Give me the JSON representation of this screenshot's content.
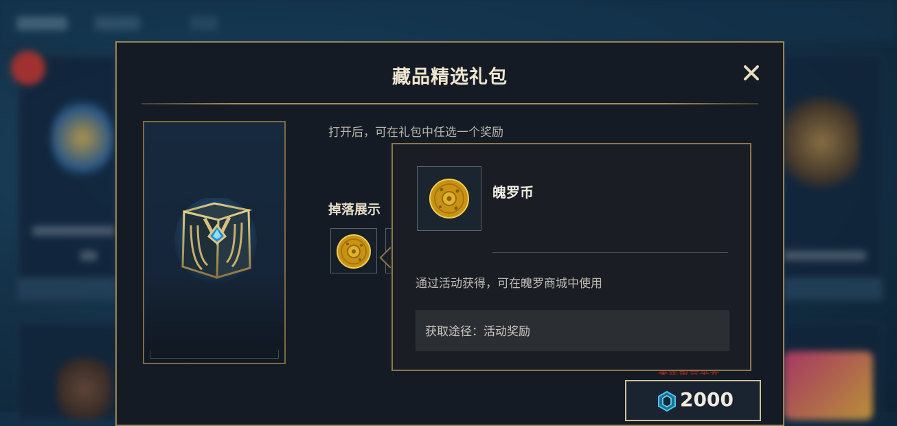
{
  "dialog": {
    "title": "藏品精选礼包",
    "subtitle": "打开后，可在礼包中任选一个奖励",
    "drop_title": "掉落展示",
    "price_note": "来年留合平光",
    "price": "2000"
  },
  "tooltip": {
    "item_name": "魄罗币",
    "description": "通过活动获得，可在魄罗商城中使用",
    "source": "获取途径：活动奖励"
  },
  "colors": {
    "gold_border": "#9b8457",
    "dialog_bg": "#141b24",
    "coin_gold": "#d9a81e",
    "gem_cyan": "#2fb7e6"
  },
  "icons": [
    "close-icon",
    "chest-icon",
    "poro-coin-icon",
    "gem-currency-icon",
    "check-icon"
  ]
}
